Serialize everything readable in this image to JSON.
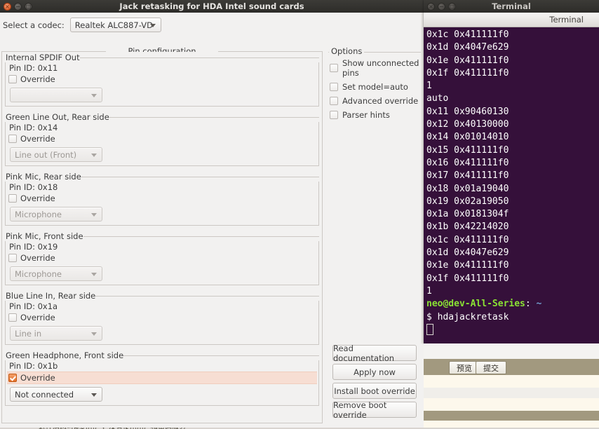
{
  "app": {
    "title": "Jack retasking for HDA Intel sound cards",
    "titlebar_buttons": [
      {
        "name": "close",
        "glyph": "×"
      },
      {
        "name": "minimize",
        "glyph": "−"
      },
      {
        "name": "maximize",
        "glyph": "□"
      }
    ],
    "codec": {
      "label": "Select a codec:",
      "value": "Realtek ALC887-VD"
    },
    "pin_configuration": {
      "legend": "Pin configuration",
      "groups": [
        {
          "title": "Internal SPDIF Out",
          "pin_id": "Pin ID: 0x11",
          "override_label": "Override",
          "override_checked": false,
          "select_value": "",
          "select_disabled": true
        },
        {
          "title": "Green Line Out, Rear side",
          "pin_id": "Pin ID: 0x14",
          "override_label": "Override",
          "override_checked": false,
          "select_value": "Line out (Front)",
          "select_disabled": true
        },
        {
          "title": "Pink Mic, Rear side",
          "pin_id": "Pin ID: 0x18",
          "override_label": "Override",
          "override_checked": false,
          "select_value": "Microphone",
          "select_disabled": true
        },
        {
          "title": "Pink Mic, Front side",
          "pin_id": "Pin ID: 0x19",
          "override_label": "Override",
          "override_checked": false,
          "select_value": "Microphone",
          "select_disabled": true
        },
        {
          "title": "Blue Line In, Rear side",
          "pin_id": "Pin ID: 0x1a",
          "override_label": "Override",
          "override_checked": false,
          "select_value": "Line in",
          "select_disabled": true
        },
        {
          "title": "Green Headphone, Front side",
          "pin_id": "Pin ID: 0x1b",
          "override_label": "Override",
          "override_checked": true,
          "select_value": "Not connected",
          "select_disabled": false
        }
      ]
    },
    "options": {
      "legend": "Options",
      "items": [
        {
          "label": "Show unconnected pins",
          "checked": false
        },
        {
          "label": "Set model=auto",
          "checked": false
        },
        {
          "label": "Advanced override",
          "checked": false
        },
        {
          "label": "Parser hints",
          "checked": false
        }
      ]
    },
    "buttons": [
      {
        "label": "Read documentation"
      },
      {
        "label": "Apply now"
      },
      {
        "label": "Install boot override"
      },
      {
        "label": "Remove boot override"
      }
    ]
  },
  "terminal": {
    "title": "Terminal",
    "tab_label": "Terminal",
    "colors": {
      "background": "#35103a",
      "prompt_user": "#8ae234",
      "prompt_path": "#729fcf"
    },
    "lines": [
      "0x1c 0x411111f0",
      "0x1d 0x4047e629",
      "0x1e 0x411111f0",
      "0x1f 0x411111f0",
      "1",
      "auto",
      "0x11 0x90460130",
      "0x12 0x40130000",
      "0x14 0x01014010",
      "0x15 0x411111f0",
      "0x16 0x411111f0",
      "0x17 0x411111f0",
      "0x18 0x01a19040",
      "0x19 0x02a19050",
      "0x1a 0x0181304f",
      "0x1b 0x42214020",
      "0x1c 0x411111f0",
      "0x1d 0x4047e629",
      "0x1e 0x411111f0",
      "0x1f 0x411111f0",
      "1"
    ],
    "prompt_user": "neo@dev-All-Series",
    "prompt_sep": ":",
    "prompt_path": "~",
    "command_prefix": "$ ",
    "command": "hdajackretask"
  },
  "web_fragment": {
    "preview_button": "预览",
    "submit_button": "提交"
  },
  "status_bar": {
    "text": "近件消息可能的用户，没有使用用户和密码服务"
  }
}
